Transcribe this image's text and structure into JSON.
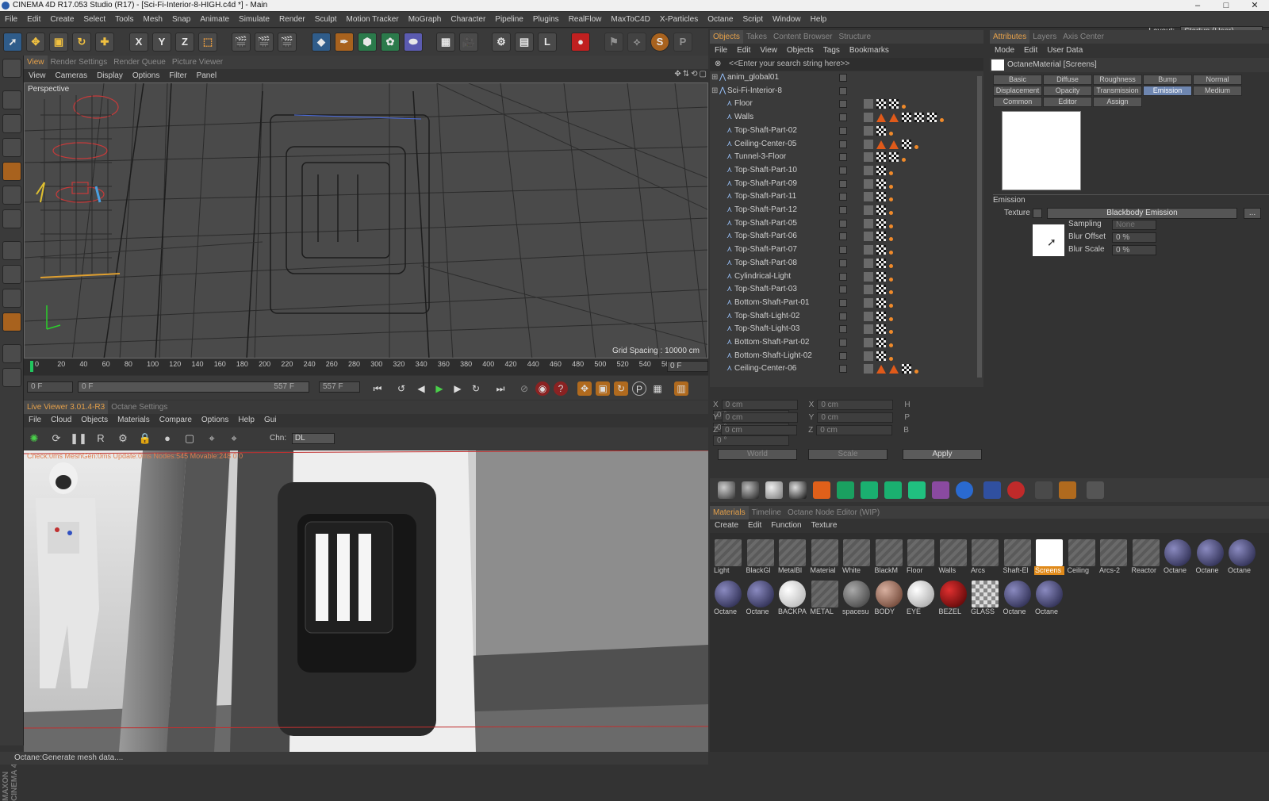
{
  "window": {
    "title": "CINEMA 4D R17.053 Studio (R17) - [Sci-Fi-Interior-8-HIGH.c4d *] - Main",
    "controls": [
      "–",
      "□",
      "✕"
    ]
  },
  "menu": [
    "File",
    "Edit",
    "Create",
    "Select",
    "Tools",
    "Mesh",
    "Snap",
    "Animate",
    "Simulate",
    "Render",
    "Sculpt",
    "Motion Tracker",
    "MoGraph",
    "Character",
    "Pipeline",
    "Plugins",
    "RealFlow",
    "MaxToC4D",
    "X-Particles",
    "Octane",
    "Script",
    "Window",
    "Help"
  ],
  "layout": {
    "label": "Layout:",
    "value": "Startup (User)"
  },
  "viewport": {
    "tabs": [
      "View",
      "Render Settings",
      "Render Queue",
      "Picture Viewer"
    ],
    "menu": [
      "View",
      "Cameras",
      "Display",
      "Options",
      "Filter",
      "Panel"
    ],
    "label": "Perspective",
    "grid_spacing": "Grid Spacing : 10000 cm"
  },
  "timeline": {
    "ticks": [
      "0",
      "20",
      "40",
      "60",
      "80",
      "100",
      "120",
      "140",
      "160",
      "180",
      "200",
      "220",
      "240",
      "260",
      "280",
      "300",
      "320",
      "340",
      "360",
      "380",
      "400",
      "420",
      "440",
      "460",
      "480",
      "500",
      "520",
      "540",
      "56"
    ],
    "current": "0 F"
  },
  "transport": {
    "start": "0 F",
    "range_start": "0 F",
    "range_end": "557 F",
    "end": "557 F"
  },
  "liveviewer": {
    "tabs": [
      "Live Viewer 3.01.4-R3",
      "Octane Settings"
    ],
    "menu": [
      "File",
      "Cloud",
      "Objects",
      "Materials",
      "Compare",
      "Options",
      "Help",
      "Gui"
    ],
    "chn_label": "Chn:",
    "chn_value": "DL",
    "stats": "Check:0ms  MeshGen:0ms  Update:0ms  Nodes:545 Movable:248 0 0"
  },
  "status": "Octane:Generate mesh data....",
  "objects": {
    "tabs": [
      "Objects",
      "Takes",
      "Content Browser",
      "Structure"
    ],
    "menu": [
      "File",
      "Edit",
      "View",
      "Objects",
      "Tags",
      "Bookmarks"
    ],
    "search_placeholder": "<<Enter your search string here>>",
    "rows": [
      {
        "name": "anim_global01",
        "indent": 0,
        "tags": ""
      },
      {
        "name": "Sci-Fi-Interior-8",
        "indent": 0,
        "tags": ""
      },
      {
        "name": "Floor",
        "indent": 1,
        "tags": "gccd"
      },
      {
        "name": "Walls",
        "indent": 1,
        "tags": "gttcccd"
      },
      {
        "name": "Top-Shaft-Part-02",
        "indent": 1,
        "tags": "gcd"
      },
      {
        "name": "Ceiling-Center-05",
        "indent": 1,
        "tags": "gttcd"
      },
      {
        "name": "Tunnel-3-Floor",
        "indent": 1,
        "tags": "gccd"
      },
      {
        "name": "Top-Shaft-Part-10",
        "indent": 1,
        "tags": "gcd"
      },
      {
        "name": "Top-Shaft-Part-09",
        "indent": 1,
        "tags": "gcd"
      },
      {
        "name": "Top-Shaft-Part-11",
        "indent": 1,
        "tags": "gcd"
      },
      {
        "name": "Top-Shaft-Part-12",
        "indent": 1,
        "tags": "gcd"
      },
      {
        "name": "Top-Shaft-Part-05",
        "indent": 1,
        "tags": "gcd"
      },
      {
        "name": "Top-Shaft-Part-06",
        "indent": 1,
        "tags": "gcd"
      },
      {
        "name": "Top-Shaft-Part-07",
        "indent": 1,
        "tags": "gcd"
      },
      {
        "name": "Top-Shaft-Part-08",
        "indent": 1,
        "tags": "gcd"
      },
      {
        "name": "Cylindrical-Light",
        "indent": 1,
        "tags": "gcd"
      },
      {
        "name": "Top-Shaft-Part-03",
        "indent": 1,
        "tags": "gcd"
      },
      {
        "name": "Bottom-Shaft-Part-01",
        "indent": 1,
        "tags": "gcd"
      },
      {
        "name": "Top-Shaft-Light-02",
        "indent": 1,
        "tags": "gcd"
      },
      {
        "name": "Top-Shaft-Light-03",
        "indent": 1,
        "tags": "gcd"
      },
      {
        "name": "Bottom-Shaft-Part-02",
        "indent": 1,
        "tags": "gcd"
      },
      {
        "name": "Bottom-Shaft-Light-02",
        "indent": 1,
        "tags": "gcd"
      },
      {
        "name": "Ceiling-Center-06",
        "indent": 1,
        "tags": "gttcd"
      }
    ]
  },
  "coords": {
    "rows": [
      [
        "X",
        "0 cm",
        "X",
        "0 cm",
        "H",
        "0 °"
      ],
      [
        "Y",
        "0 cm",
        "Y",
        "0 cm",
        "P",
        "0 °"
      ],
      [
        "Z",
        "0 cm",
        "Z",
        "0 cm",
        "B",
        "0 °"
      ]
    ],
    "world": "World",
    "scale": "Scale",
    "apply": "Apply"
  },
  "materials": {
    "tabs": [
      "Materials",
      "Timeline",
      "Octane Node Editor (WIP)"
    ],
    "menu": [
      "Create",
      "Edit",
      "Function",
      "Texture"
    ],
    "row1": [
      "Light",
      "BlackGl",
      "MetalBl",
      "Material",
      "White",
      "BlackM",
      "Floor",
      "Walls",
      "Arcs",
      "Shaft-El",
      "Screens",
      "Ceiling",
      "Arcs-2",
      "Reactor",
      "Octane",
      "Octane",
      "Octane"
    ],
    "row2": [
      "Octane",
      "Octane",
      "BACKPA",
      "METAL",
      "spacesu",
      "BODY",
      "EYE",
      "BEZEL",
      "GLASS",
      "Octane",
      "Octane"
    ],
    "selected": "Screens"
  },
  "attributes": {
    "tabs": [
      "Attributes",
      "Layers",
      "Axis Center"
    ],
    "menu": [
      "Mode",
      "Edit",
      "User Data"
    ],
    "material": "OctaneMaterial [Screens]",
    "buttons": [
      "Basic",
      "Diffuse",
      "Roughness",
      "Bump",
      "Normal",
      "Displacement",
      "Opacity",
      "Transmission",
      "Emission",
      "Medium",
      "Common",
      "Editor",
      "Assign"
    ],
    "active": "Emission",
    "section": "Emission",
    "texture_label": "Texture",
    "texture_value": "Blackbody Emission",
    "sampling_label": "Sampling",
    "sampling_value": "None",
    "blur_offset_label": "Blur Offset",
    "blur_offset_value": "0 %",
    "blur_scale_label": "Blur Scale",
    "blur_scale_value": "0 %"
  },
  "maxon": "MAXON CINEMA 4D"
}
